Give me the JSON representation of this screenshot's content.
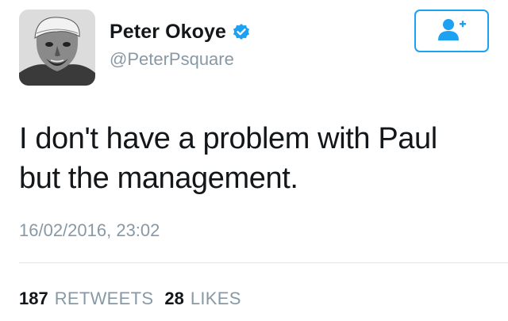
{
  "user": {
    "display_name": "Peter Okoye",
    "handle": "@PeterPsquare",
    "verified": true,
    "verified_icon": "verified-badge-icon",
    "avatar": "user-avatar"
  },
  "follow_button": {
    "icon": "add-user-icon"
  },
  "tweet": {
    "line1": "I don't have a problem with Paul",
    "line2": "but the management.",
    "timestamp": "16/02/2016, 23:02"
  },
  "stats": {
    "retweets_count": "187",
    "retweets_label": "RETWEETS",
    "likes_count": "28",
    "likes_label": "LIKES"
  },
  "colors": {
    "accent": "#1da1f2",
    "text": "#14171a",
    "muted": "#8899a6",
    "divider": "#e1e8ed"
  }
}
